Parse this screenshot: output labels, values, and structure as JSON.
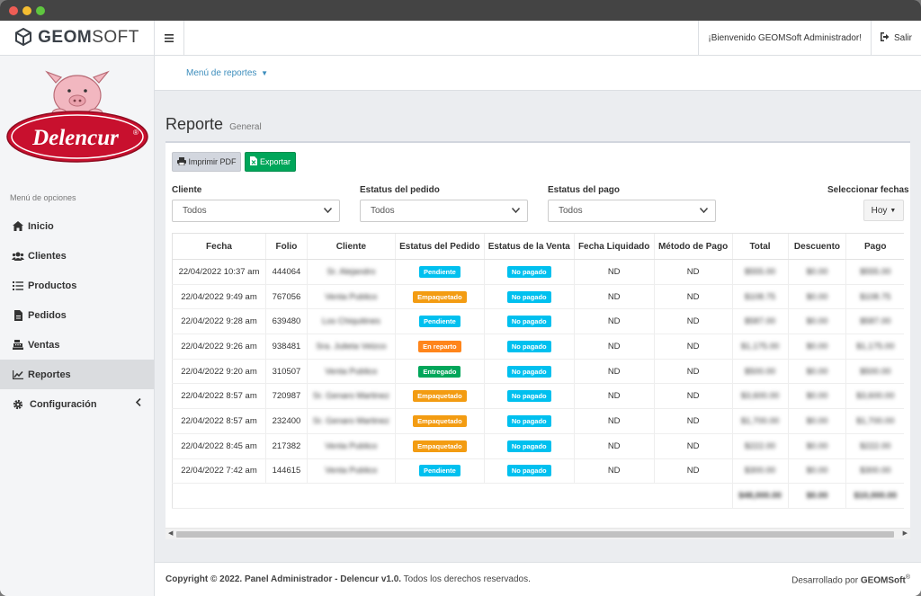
{
  "brand": {
    "name_bold": "GEOM",
    "name_light": "SOFT"
  },
  "logo": {
    "text": "Delencur",
    "mark": "®"
  },
  "sidebar": {
    "menu_title": "Menú de opciones",
    "items": [
      {
        "label": "Inicio",
        "icon": "home-icon"
      },
      {
        "label": "Clientes",
        "icon": "users-icon"
      },
      {
        "label": "Productos",
        "icon": "list-icon"
      },
      {
        "label": "Pedidos",
        "icon": "file-icon"
      },
      {
        "label": "Ventas",
        "icon": "cash-register-icon"
      },
      {
        "label": "Reportes",
        "icon": "chart-icon",
        "active": true
      },
      {
        "label": "Configuración",
        "icon": "gear-icon"
      }
    ]
  },
  "topbar": {
    "welcome": "¡Bienvenido GEOMSoft Administrador!",
    "logout": "Salir"
  },
  "subnav": {
    "reports_menu": "Menú de reportes"
  },
  "header": {
    "title": "Reporte",
    "subtitle": "General"
  },
  "toolbar": {
    "print_label": "Imprimir PDF",
    "export_label": "Exportar"
  },
  "filters": {
    "cliente": {
      "label": "Cliente",
      "value": "Todos"
    },
    "pedido": {
      "label": "Estatus del pedido",
      "value": "Todos"
    },
    "pago": {
      "label": "Estatus del pago",
      "value": "Todos"
    },
    "fechas": {
      "label": "Seleccionar fechas",
      "value": "Hoy"
    }
  },
  "table": {
    "columns": [
      "Fecha",
      "Folio",
      "Cliente",
      "Estatus del Pedido",
      "Estatus de la Venta",
      "Fecha Liquidado",
      "Método de Pago",
      "Total",
      "Descuento",
      "Pago"
    ],
    "rows": [
      {
        "fecha": "22/04/2022 10:37 am",
        "folio": "444064",
        "cliente": "Sr. Alejandro",
        "pedido": "Pendiente",
        "venta": "No pagado",
        "liquidado": "ND",
        "metodo": "ND",
        "total": "$555.00",
        "descuento": "$0.00",
        "pago": "$555.00"
      },
      {
        "fecha": "22/04/2022 9:49 am",
        "folio": "767056",
        "cliente": "Venta Publico",
        "pedido": "Empaquetado",
        "venta": "No pagado",
        "liquidado": "ND",
        "metodo": "ND",
        "total": "$108.75",
        "descuento": "$0.00",
        "pago": "$108.75"
      },
      {
        "fecha": "22/04/2022 9:28 am",
        "folio": "639480",
        "cliente": "Los Chiquitines",
        "pedido": "Pendiente",
        "venta": "No pagado",
        "liquidado": "ND",
        "metodo": "ND",
        "total": "$587.00",
        "descuento": "$0.00",
        "pago": "$587.00"
      },
      {
        "fecha": "22/04/2022 9:26 am",
        "folio": "938481",
        "cliente": "Sra. Julieta Velzco",
        "pedido": "En reparto",
        "venta": "No pagado",
        "liquidado": "ND",
        "metodo": "ND",
        "total": "$1,175.00",
        "descuento": "$0.00",
        "pago": "$1,175.00"
      },
      {
        "fecha": "22/04/2022 9:20 am",
        "folio": "310507",
        "cliente": "Venta Publico",
        "pedido": "Entregado",
        "venta": "No pagado",
        "liquidado": "ND",
        "metodo": "ND",
        "total": "$500.00",
        "descuento": "$0.00",
        "pago": "$500.00"
      },
      {
        "fecha": "22/04/2022 8:57 am",
        "folio": "720987",
        "cliente": "Sr. Genaro Martinez",
        "pedido": "Empaquetado",
        "venta": "No pagado",
        "liquidado": "ND",
        "metodo": "ND",
        "total": "$3,600.00",
        "descuento": "$0.00",
        "pago": "$3,600.00"
      },
      {
        "fecha": "22/04/2022 8:57 am",
        "folio": "232400",
        "cliente": "Sr. Genaro Martinez",
        "pedido": "Empaquetado",
        "venta": "No pagado",
        "liquidado": "ND",
        "metodo": "ND",
        "total": "$1,700.00",
        "descuento": "$0.00",
        "pago": "$1,700.00"
      },
      {
        "fecha": "22/04/2022 8:45 am",
        "folio": "217382",
        "cliente": "Venta Publico",
        "pedido": "Empaquetado",
        "venta": "No pagado",
        "liquidado": "ND",
        "metodo": "ND",
        "total": "$222.00",
        "descuento": "$0.00",
        "pago": "$222.00"
      },
      {
        "fecha": "22/04/2022 7:42 am",
        "folio": "144615",
        "cliente": "Venta Publico",
        "pedido": "Pendiente",
        "venta": "No pagado",
        "liquidado": "ND",
        "metodo": "ND",
        "total": "$300.00",
        "descuento": "$0.00",
        "pago": "$300.00"
      }
    ],
    "totals": {
      "total": "$48,000.00",
      "descuento": "$0.00",
      "pago": "$10,000.00"
    }
  },
  "status_colors": {
    "Pendiente": "#00c0ef",
    "Empaquetado": "#f39c12",
    "En reparto": "#ff851b",
    "Entregado": "#00a65a",
    "No pagado": "#00c0ef"
  },
  "footer": {
    "copyright": "Copyright © 2022. Panel Administrador - Delencur v1.0.",
    "rights": " Todos los derechos reservados.",
    "dev_prefix": "Desarrollado por ",
    "dev_name": "GEOMSoft",
    "dev_mark": "®"
  }
}
